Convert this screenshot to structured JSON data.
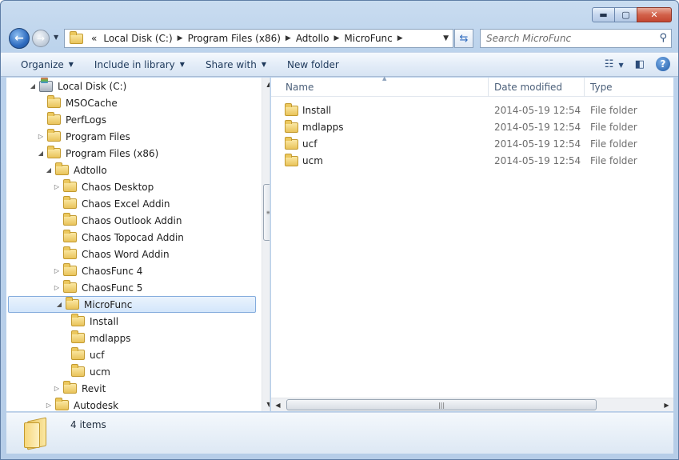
{
  "window": {
    "buttons": {
      "minimize": "▬",
      "maximize": "▢",
      "close": "✕"
    }
  },
  "nav": {
    "address": [
      "«",
      "Local Disk (C:)",
      "Program Files (x86)",
      "Adtollo",
      "MicroFunc"
    ],
    "search_placeholder": "Search MicroFunc"
  },
  "toolbar": {
    "organize": "Organize",
    "include_library": "Include in library",
    "share_with": "Share with",
    "new_folder": "New folder"
  },
  "tree": [
    {
      "label": "Local Disk (C:)",
      "indent": 1,
      "toggle": "◢",
      "icon": "disk"
    },
    {
      "label": "MSOCache",
      "indent": 2,
      "toggle": "",
      "icon": "folder"
    },
    {
      "label": "PerfLogs",
      "indent": 2,
      "toggle": "",
      "icon": "folder"
    },
    {
      "label": "Program Files",
      "indent": 2,
      "toggle": "▷",
      "icon": "folder"
    },
    {
      "label": "Program Files (x86)",
      "indent": 2,
      "toggle": "◢",
      "icon": "folder"
    },
    {
      "label": "Adtollo",
      "indent": 3,
      "toggle": "◢",
      "icon": "folder"
    },
    {
      "label": "Chaos Desktop",
      "indent": 4,
      "toggle": "▷",
      "icon": "folder"
    },
    {
      "label": "Chaos Excel Addin",
      "indent": 4,
      "toggle": "",
      "icon": "folder"
    },
    {
      "label": "Chaos Outlook Addin",
      "indent": 4,
      "toggle": "",
      "icon": "folder"
    },
    {
      "label": "Chaos Topocad Addin",
      "indent": 4,
      "toggle": "",
      "icon": "folder"
    },
    {
      "label": "Chaos Word Addin",
      "indent": 4,
      "toggle": "",
      "icon": "folder"
    },
    {
      "label": "ChaosFunc 4",
      "indent": 4,
      "toggle": "▷",
      "icon": "folder"
    },
    {
      "label": "ChaosFunc 5",
      "indent": 4,
      "toggle": "▷",
      "icon": "folder"
    },
    {
      "label": "MicroFunc",
      "indent": 4,
      "toggle": "◢",
      "icon": "folder",
      "selected": true
    },
    {
      "label": "Install",
      "indent": 5,
      "toggle": "",
      "icon": "folder"
    },
    {
      "label": "mdlapps",
      "indent": 5,
      "toggle": "",
      "icon": "folder"
    },
    {
      "label": "ucf",
      "indent": 5,
      "toggle": "",
      "icon": "folder"
    },
    {
      "label": "ucm",
      "indent": 5,
      "toggle": "",
      "icon": "folder"
    },
    {
      "label": "Revit",
      "indent": 4,
      "toggle": "▷",
      "icon": "folder"
    },
    {
      "label": "Autodesk",
      "indent": 3,
      "toggle": "▷",
      "icon": "folder"
    }
  ],
  "columns": {
    "name": "Name",
    "date": "Date modified",
    "type": "Type"
  },
  "files": [
    {
      "name": "Install",
      "date": "2014-05-19 12:54",
      "type": "File folder"
    },
    {
      "name": "mdlapps",
      "date": "2014-05-19 12:54",
      "type": "File folder"
    },
    {
      "name": "ucf",
      "date": "2014-05-19 12:54",
      "type": "File folder"
    },
    {
      "name": "ucm",
      "date": "2014-05-19 12:54",
      "type": "File folder"
    }
  ],
  "details": {
    "count": "4 items"
  }
}
